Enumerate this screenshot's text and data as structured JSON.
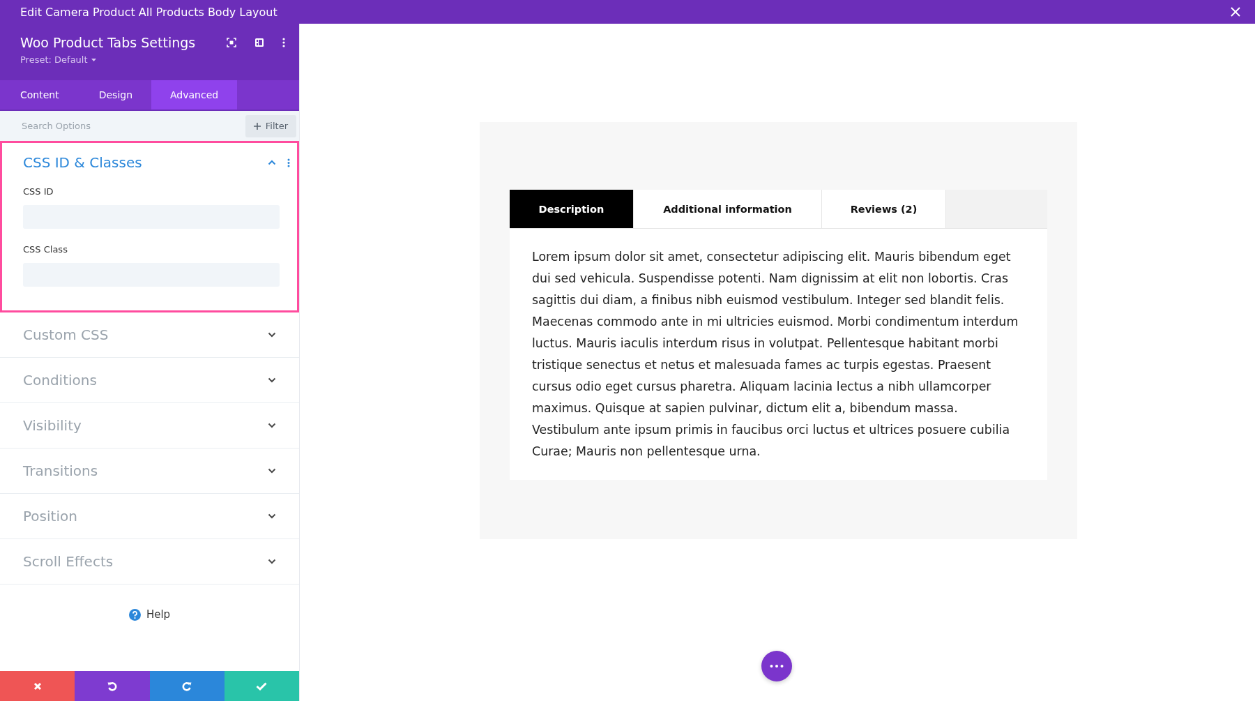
{
  "window": {
    "title": "Edit Camera Product All Products Body Layout"
  },
  "panel": {
    "title": "Woo Product Tabs Settings",
    "preset": "Preset: Default",
    "tabs": [
      {
        "label": "Content",
        "selected": false
      },
      {
        "label": "Design",
        "selected": false
      },
      {
        "label": "Advanced",
        "selected": true
      }
    ],
    "search": {
      "placeholder": "Search Options"
    },
    "filter_button": "Filter",
    "sections": [
      {
        "title": "CSS ID & Classes",
        "expanded": true,
        "fields": [
          {
            "label": "CSS ID"
          },
          {
            "label": "CSS Class"
          }
        ]
      },
      {
        "title": "Custom CSS",
        "expanded": false
      },
      {
        "title": "Conditions",
        "expanded": false
      },
      {
        "title": "Visibility",
        "expanded": false
      },
      {
        "title": "Transitions",
        "expanded": false
      },
      {
        "title": "Position",
        "expanded": false
      },
      {
        "title": "Scroll Effects",
        "expanded": false
      }
    ],
    "help": "Help"
  },
  "preview": {
    "tabs": [
      {
        "label": "Description",
        "selected": true
      },
      {
        "label": "Additional information",
        "selected": false
      },
      {
        "label": "Reviews (2)",
        "selected": false
      }
    ],
    "body": "Lorem ipsum dolor sit amet, consectetur adipiscing elit. Mauris bibendum eget dui sed vehicula. Suspendisse potenti. Nam dignissim at elit non lobortis. Cras sagittis dui diam, a finibus nibh euismod vestibulum. Integer sed blandit felis. Maecenas commodo ante in mi ultricies euismod. Morbi condimentum interdum luctus. Mauris iaculis interdum risus in volutpat. Pellentesque habitant morbi tristique senectus et netus et malesuada fames ac turpis egestas. Praesent cursus odio eget cursus pharetra. Aliquam lacinia lectus a nibh ullamcorper maximus. Quisque at sapien pulvinar, dictum elit a, bibendum massa. Vestibulum ante ipsum primis in faucibus orci luctus et ultrices posuere cubilia Curae; Mauris non pellentesque urna."
  }
}
